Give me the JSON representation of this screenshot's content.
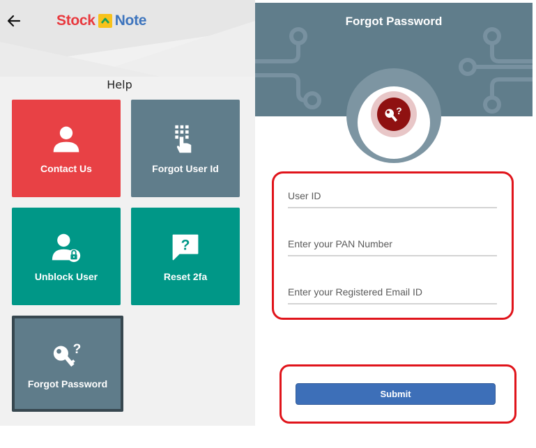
{
  "header": {
    "logo_left": "Stock",
    "logo_right": "Note",
    "back_icon": "arrow-left-icon"
  },
  "help": {
    "title": "Help",
    "tiles": [
      {
        "label": "Contact Us",
        "icon": "user-icon",
        "color": "#e84145"
      },
      {
        "label": "Forgot User Id",
        "icon": "keypad-touch-icon",
        "color": "#607d8b"
      },
      {
        "label": "Unblock User",
        "icon": "user-lock-icon",
        "color": "#009787"
      },
      {
        "label": "Reset 2fa",
        "icon": "question-chat-icon",
        "color": "#009787"
      },
      {
        "label": "Forgot Password",
        "icon": "key-question-icon",
        "color": "#5f7c8a"
      }
    ]
  },
  "forgot_password": {
    "title": "Forgot Password",
    "icon": "key-question-icon",
    "fields": {
      "user_id": {
        "placeholder": "User ID",
        "value": ""
      },
      "pan": {
        "placeholder": "Enter your PAN Number",
        "value": ""
      },
      "email": {
        "placeholder": "Enter your Registered Email ID",
        "value": ""
      }
    },
    "submit_label": "Submit"
  },
  "colors": {
    "accent_red": "#e84145",
    "slate": "#607d8b",
    "teal": "#009787",
    "button_blue": "#3d6fb8",
    "highlight_red": "#e0141b"
  }
}
